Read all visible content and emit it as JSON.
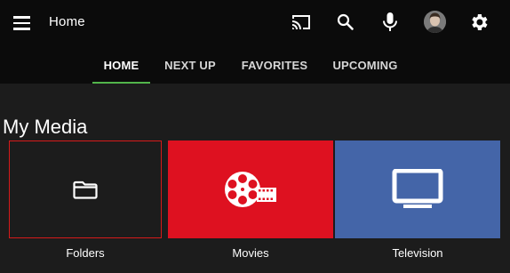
{
  "header": {
    "title": "Home",
    "background": "#0b0b0b",
    "icons": [
      "menu-icon",
      "cast-icon",
      "search-icon",
      "microphone-icon",
      "user-avatar",
      "settings-icon"
    ]
  },
  "tabs": [
    {
      "label": "HOME",
      "active": true
    },
    {
      "label": "NEXT UP",
      "active": false
    },
    {
      "label": "FAVORITES",
      "active": false
    },
    {
      "label": "UPCOMING",
      "active": false
    }
  ],
  "accent_color": "#52b54b",
  "section": {
    "title": "My Media",
    "libraries": [
      {
        "label": "Folders",
        "icon": "folder-icon",
        "color": "#1c1c1c",
        "focused": true,
        "focus_color": "#d61a1a"
      },
      {
        "label": "Movies",
        "icon": "film-reel-icon",
        "color": "#de1120",
        "focused": false
      },
      {
        "label": "Television",
        "icon": "tv-icon",
        "color": "#4465a8",
        "focused": false
      }
    ]
  }
}
